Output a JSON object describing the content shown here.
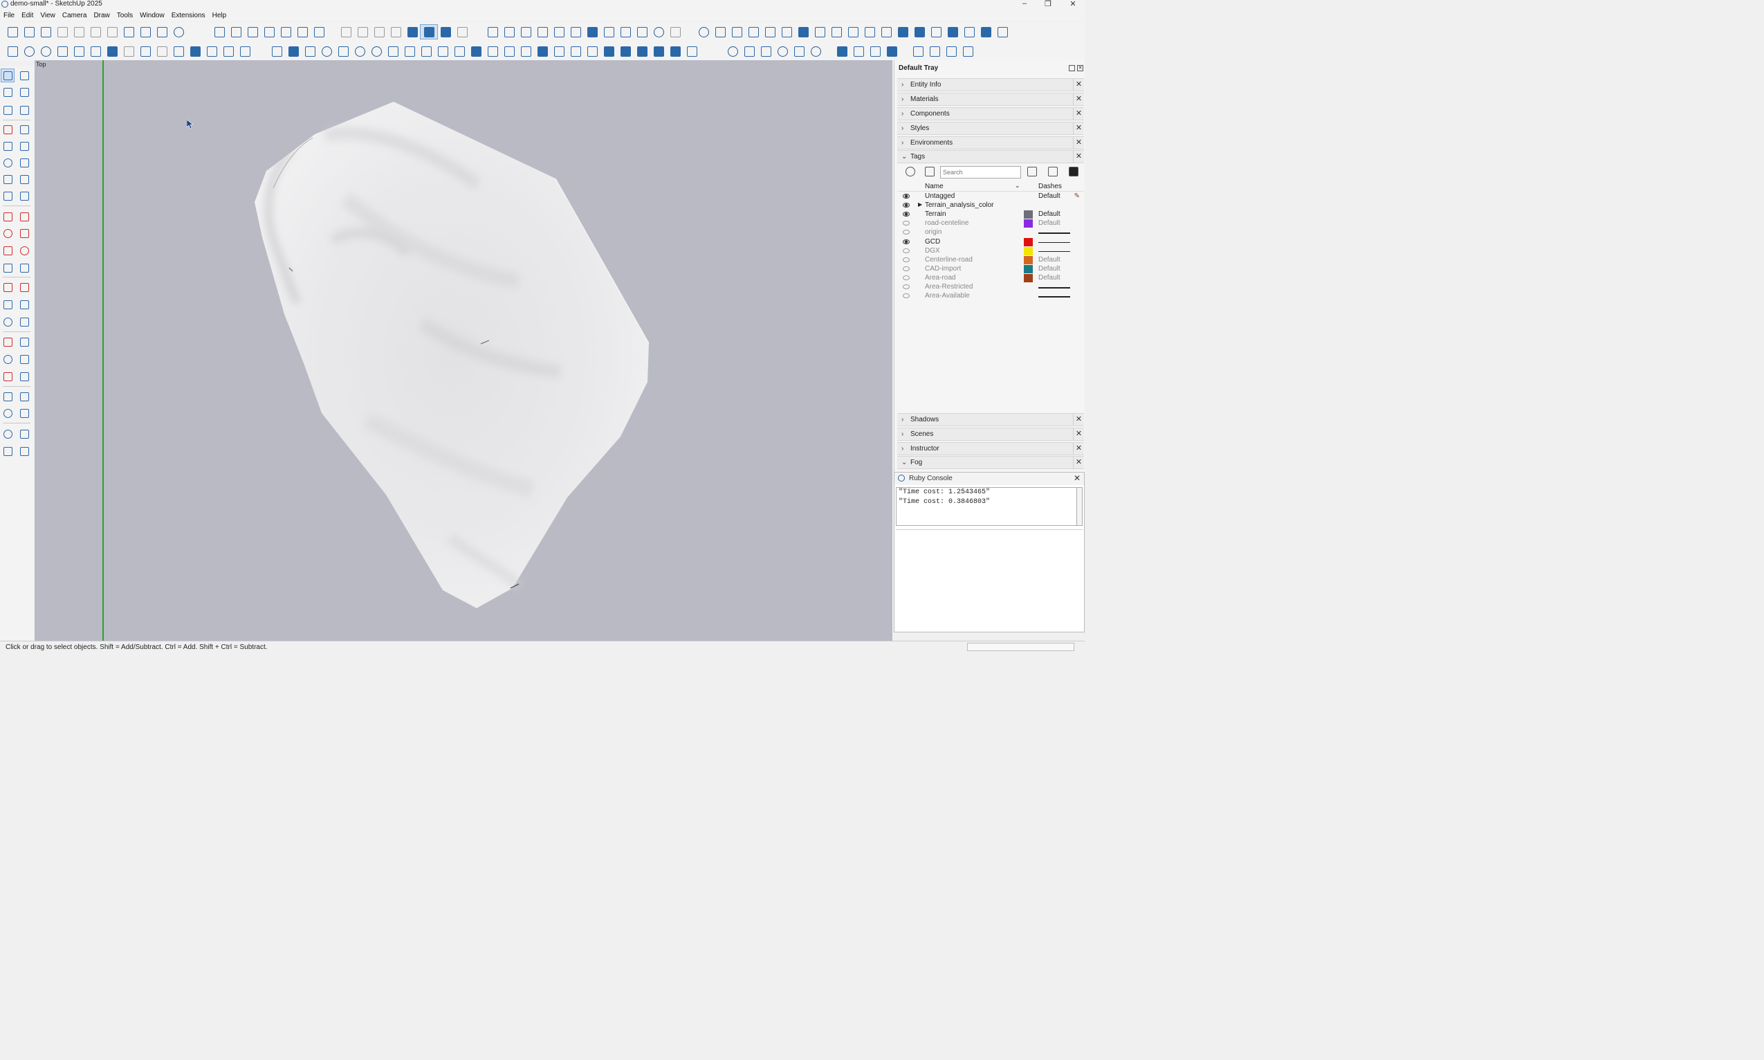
{
  "window": {
    "title": "demo-small* - SketchUp 2025"
  },
  "menu": [
    "File",
    "Edit",
    "View",
    "Camera",
    "Draw",
    "Tools",
    "Window",
    "Extensions",
    "Help"
  ],
  "viewport": {
    "view_name": "Top"
  },
  "tray": {
    "title": "Default Tray",
    "panels_top": [
      {
        "label": "Entity Info",
        "expanded": false
      },
      {
        "label": "Materials",
        "expanded": false
      },
      {
        "label": "Components",
        "expanded": false
      },
      {
        "label": "Styles",
        "expanded": false
      },
      {
        "label": "Environments",
        "expanded": false
      },
      {
        "label": "Tags",
        "expanded": true
      }
    ],
    "panels_bottom": [
      {
        "label": "Shadows",
        "expanded": false
      },
      {
        "label": "Scenes",
        "expanded": false
      },
      {
        "label": "Instructor",
        "expanded": false
      },
      {
        "label": "Fog",
        "expanded": true
      }
    ]
  },
  "tags": {
    "search_placeholder": "Search",
    "col_name": "Name",
    "col_dashes": "Dashes",
    "rows": [
      {
        "name": "Untagged",
        "visible": true,
        "color": null,
        "dashes": "Default",
        "pencil": true
      },
      {
        "name": "Terrain_analysis_color",
        "visible": true,
        "color": null,
        "dashes": "",
        "folder": true
      },
      {
        "name": "Terrain",
        "visible": true,
        "color": "#6e6e7a",
        "dashes": "Default"
      },
      {
        "name": "road-centeline",
        "visible": false,
        "color": "#8a2be2",
        "dashes": "Default"
      },
      {
        "name": "origin",
        "visible": false,
        "color": null,
        "dashes": "line"
      },
      {
        "name": "GCD",
        "visible": true,
        "color": "#e01010",
        "dashes": "line"
      },
      {
        "name": "DGX",
        "visible": false,
        "color": "#f2e600",
        "dashes": "line"
      },
      {
        "name": "Centerline-road",
        "visible": false,
        "color": "#d2691e",
        "dashes": "Default"
      },
      {
        "name": "CAD-import",
        "visible": false,
        "color": "#1a7a86",
        "dashes": "Default"
      },
      {
        "name": "Area-road",
        "visible": false,
        "color": "#a0401a",
        "dashes": "Default"
      },
      {
        "name": "Area-Restricted",
        "visible": false,
        "color": null,
        "dashes": "line"
      },
      {
        "name": "Area-Available",
        "visible": false,
        "color": null,
        "dashes": "line"
      }
    ]
  },
  "console": {
    "title": "Ruby Console",
    "output": [
      "\"Time cost: 1.2543465\"",
      "\"Time cost: 0.3846803\""
    ]
  },
  "status": {
    "message": "Click or drag to select objects. Shift = Add/Subtract. Ctrl = Add. Shift + Ctrl = Subtract."
  }
}
